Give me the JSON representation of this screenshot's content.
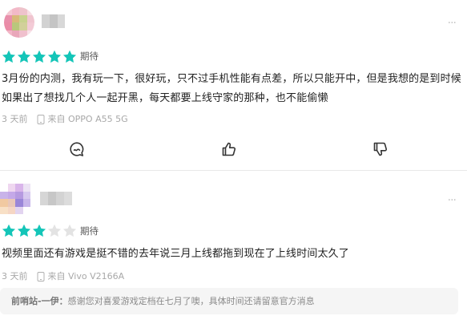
{
  "reviews": [
    {
      "stars_filled": 5,
      "stars_total": 5,
      "rating_label": "期待",
      "text": "3月份的内测，我有玩一下，很好玩，只不过手机性能有点差，所以只能开中，但是我想的是到时候如果出了想找几个人一起开黑，每天都要上线守家的那种，也不能偷懒",
      "time": "3 天前",
      "device": "来自 OPPO A55 5G"
    },
    {
      "stars_filled": 3,
      "stars_total": 5,
      "rating_label": "期待",
      "text": "视频里面还有游戏是挺不错的去年说三月上线都拖到现在了上线时间太久了",
      "time": "3 天前",
      "device": "来自 Vivo V2166A"
    }
  ],
  "reply": {
    "author": "前哨站-一伊：",
    "text": "感谢您对喜爱游戏定档在七月了噢，具体时间还请留意官方消息"
  },
  "colors": {
    "star_filled": "#14c5b8",
    "star_empty": "#e3e3e3"
  },
  "icons": {
    "comment": "comment-icon",
    "like": "thumbs-up-icon",
    "dislike": "thumbs-down-icon",
    "device": "phone-icon",
    "more": "more-dots-icon"
  }
}
